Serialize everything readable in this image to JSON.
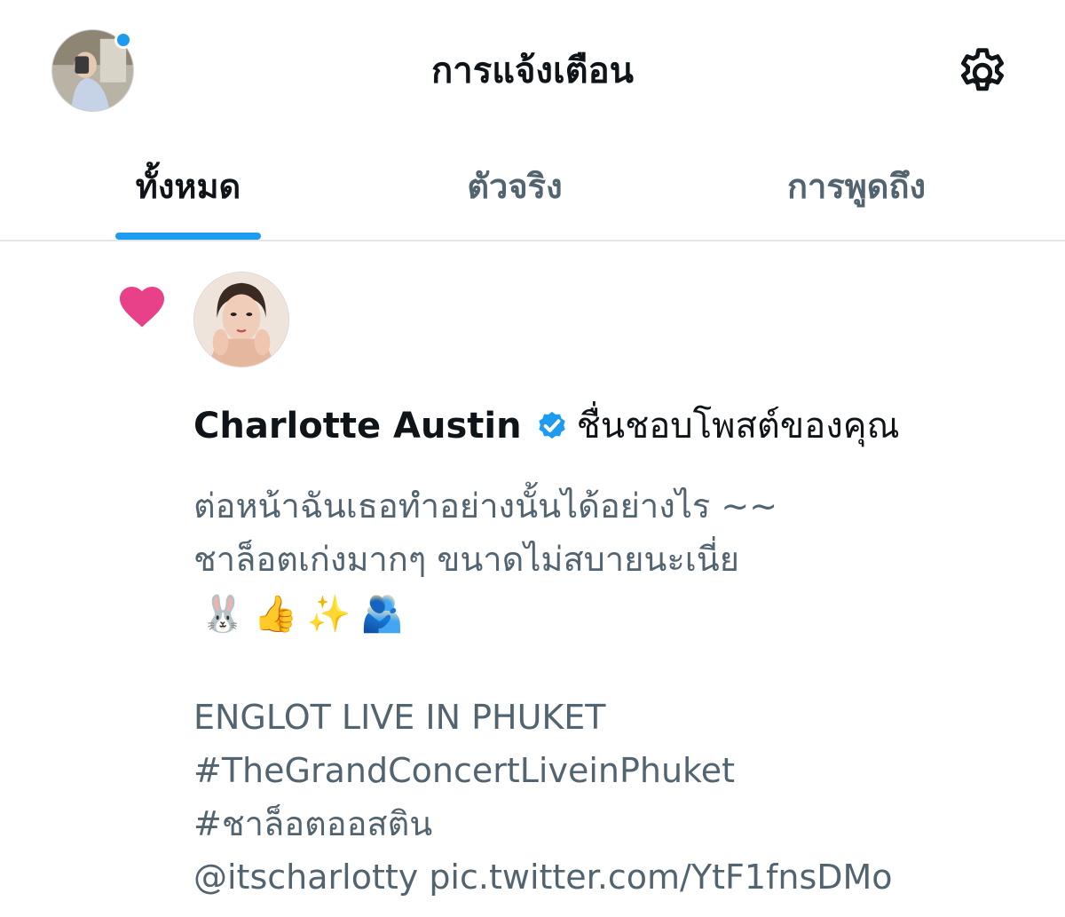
{
  "header": {
    "title": "การแจ้งเตือน",
    "avatar_icon": "profile-avatar",
    "settings_icon": "gear-icon",
    "accent_color": "#1d9bf0"
  },
  "tabs": [
    {
      "label": "ทั้งหมด",
      "active": true
    },
    {
      "label": "ตัวจริง",
      "active": false
    },
    {
      "label": "การพูดถึง",
      "active": false
    }
  ],
  "notification": {
    "type_icon": "heart-icon",
    "type_color": "#e8418a",
    "user_name": "Charlotte Austin",
    "verified": true,
    "action": "ชื่นชอบโพสต์ของคุณ",
    "tweet_lines": [
      "ต่อหน้าฉันเธอทำอย่างนั้นได้อย่างไร ~~",
      "ชาล็อตเก่งมากๆ ขนาดไม่สบายนะเนี่ย"
    ],
    "emojis": [
      "🐰",
      "👍",
      "✨",
      "🫂"
    ],
    "tweet_extra_lines": [
      "ENGLOT LIVE IN PHUKET",
      "#TheGrandConcertLiveinPhuket",
      "#ชาล็อตออสติน",
      "@itscharlotty pic.twitter.com/YtF1fnsDMo"
    ]
  }
}
